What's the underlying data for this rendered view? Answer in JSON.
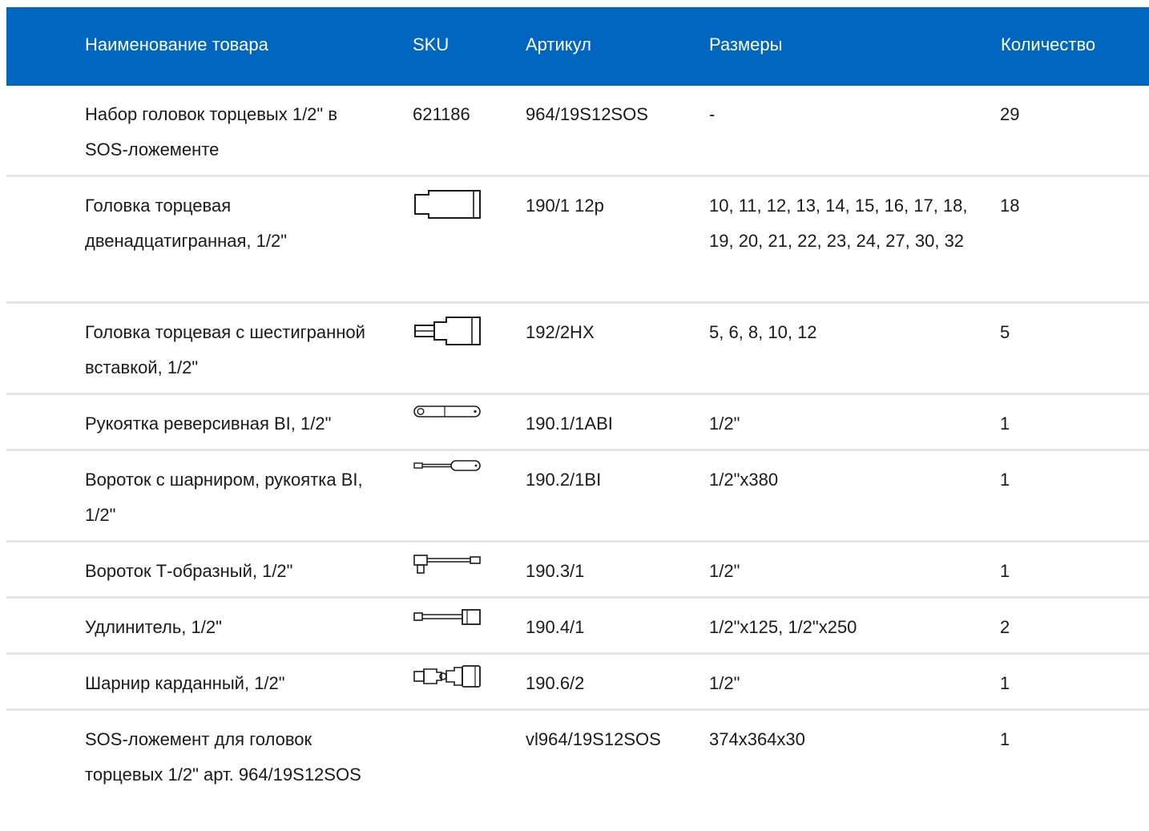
{
  "columns": {
    "name": "Наименование товара",
    "sku": "SKU",
    "article": "Артикул",
    "sizes": "Размеры",
    "quantity": "Количество"
  },
  "rows": [
    {
      "name": "Набор головок торцевых 1/2\" в SOS-ложементе",
      "sku": "621186",
      "icon": "",
      "article": "964/19S12SOS",
      "sizes": "-",
      "quantity": "29"
    },
    {
      "name": "Головка торцевая двенадцатигранная, 1/2\"",
      "sku": "",
      "icon": "socket-icon",
      "article": "190/1 12p",
      "sizes": "10, 11, 12, 13, 14, 15, 16, 17, 18, 19, 20, 21, 22, 23, 24, 27, 30, 32",
      "quantity": "18"
    },
    {
      "name": "Головка торцевая с шестигранной вставкой, 1/2\"",
      "sku": "",
      "icon": "hex-bit-socket-icon",
      "article": "192/2HX",
      "sizes": "5, 6, 8, 10, 12",
      "quantity": "5"
    },
    {
      "name": "Рукоятка реверсивная BI, 1/2\"",
      "sku": "",
      "icon": "ratchet-icon",
      "article": "190.1/1ABI",
      "sizes": "1/2\"",
      "quantity": "1"
    },
    {
      "name": "Вороток с шарниром, рукоятка BI, 1/2\"",
      "sku": "",
      "icon": "breaker-bar-icon",
      "article": "190.2/1BI",
      "sizes": "1/2\"x380",
      "quantity": "1"
    },
    {
      "name": "Вороток Т-образный, 1/2\"",
      "sku": "",
      "icon": "t-handle-icon",
      "article": "190.3/1",
      "sizes": "1/2\"",
      "quantity": "1"
    },
    {
      "name": "Удлинитель, 1/2\"",
      "sku": "",
      "icon": "extension-bar-icon",
      "article": "190.4/1",
      "sizes": "1/2\"x125, 1/2\"x250",
      "quantity": "2"
    },
    {
      "name": "Шарнир карданный, 1/2\"",
      "sku": "",
      "icon": "universal-joint-icon",
      "article": "190.6/2",
      "sizes": "1/2\"",
      "quantity": "1"
    },
    {
      "name": "SOS-ложемент для головок торцевых 1/2\" арт. 964/19S12SOS",
      "sku": "",
      "icon": "",
      "article": "vl964/19S12SOS",
      "sizes": "374x364x30",
      "quantity": "1"
    }
  ],
  "colors": {
    "header_bg": "#0066bf",
    "divider": "#e6e6e6"
  }
}
